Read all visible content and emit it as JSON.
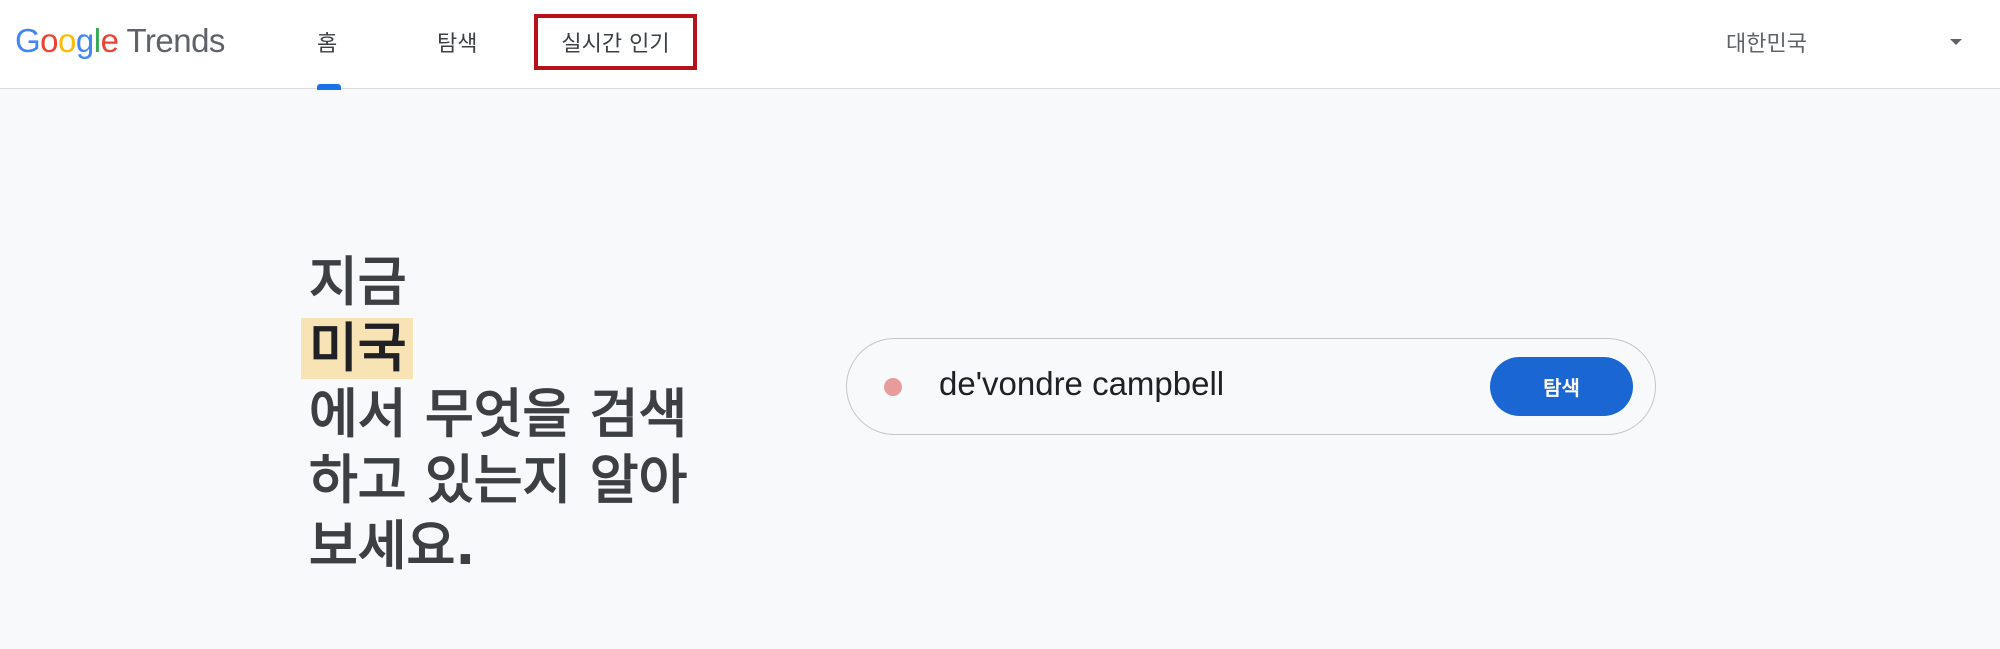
{
  "header": {
    "logo": {
      "letters": [
        "G",
        "o",
        "o",
        "g",
        "l",
        "e"
      ],
      "product": "Trends"
    },
    "tabs": [
      {
        "label": "홈",
        "active": true
      },
      {
        "label": "탐색",
        "active": false
      },
      {
        "label": "실시간 인기",
        "active": false
      }
    ],
    "country": "대한민국",
    "country_icon": "caret-down-icon"
  },
  "hero": {
    "line1": "지금",
    "highlight": "미국",
    "line3": "에서 무엇을 검색",
    "line4": "하고 있는지 알아",
    "line5": "보세요."
  },
  "search": {
    "dot_color": "#e89b9b",
    "query": "de'vondre campbell",
    "button_label": "탐색"
  },
  "colors": {
    "accent": "#1a73e8",
    "button": "#1a66d2",
    "highlight": "#f8e3b4",
    "annotation_box": "#b5121b"
  }
}
